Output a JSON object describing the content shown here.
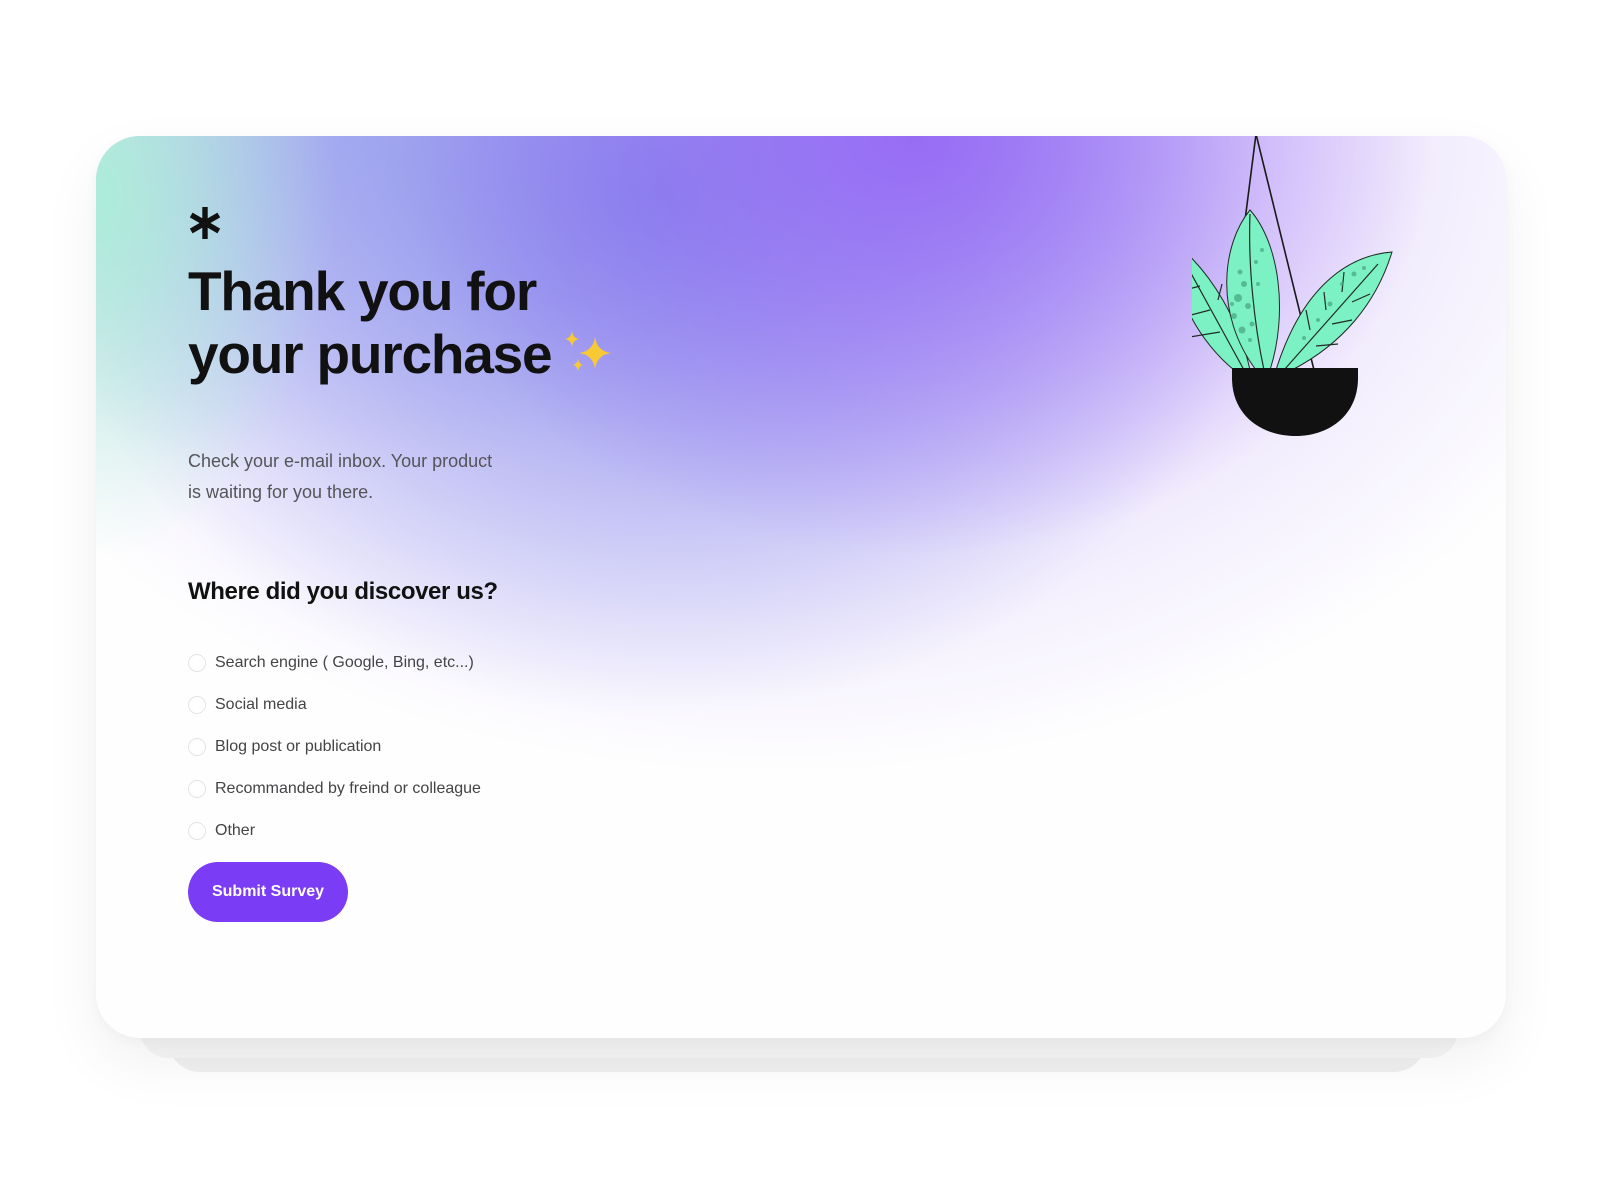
{
  "hero": {
    "title_line_1": "Thank you for",
    "title_line_2": "your purchase",
    "subtitle_line_1": "Check your e-mail inbox. Your product",
    "subtitle_line_2": "is waiting for you there."
  },
  "survey": {
    "question": "Where did you discover us?",
    "options": [
      {
        "label": "Search engine ( Google, Bing, etc...)",
        "selected": false
      },
      {
        "label": "Social media",
        "selected": false
      },
      {
        "label": "Blog post or publication",
        "selected": false
      },
      {
        "label": "Recommanded by freind or colleague",
        "selected": false
      },
      {
        "label": "Other",
        "selected": false
      }
    ],
    "submit_label": "Submit Survey"
  },
  "icons": {
    "logo": "asterisk-icon",
    "decoration": "sparkles-icon",
    "illustration": "hanging-plant-illustration"
  },
  "colors": {
    "primary": "#7a3cf5",
    "heading": "#111111",
    "body_text": "#555459",
    "plant_leaf": "#7cf2c4",
    "plant_pot": "#111111",
    "gradient_mint": "#aaeed6",
    "gradient_violet": "#9669f5",
    "gradient_periwinkle": "#7d87e8"
  }
}
